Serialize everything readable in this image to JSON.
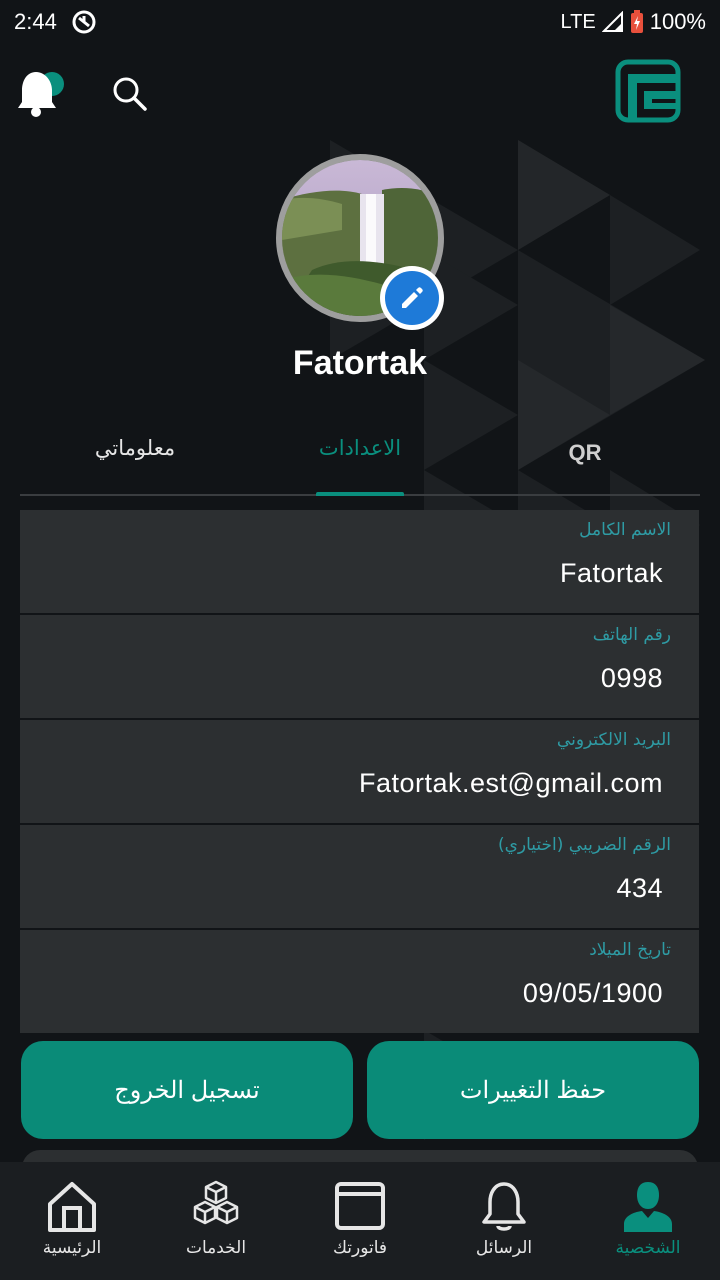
{
  "status_bar": {
    "time": "2:44",
    "network": "LTE",
    "battery": "100%"
  },
  "profile": {
    "name": "Fatortak"
  },
  "tabs": [
    {
      "label": "معلوماتي"
    },
    {
      "label": "الاعدادات"
    },
    {
      "label": "QR"
    }
  ],
  "form": {
    "fields": [
      {
        "label": "الاسم الكامل",
        "value": "Fatortak"
      },
      {
        "label": "رقم الهاتف",
        "value": "0998"
      },
      {
        "label": "البريد الالكتروني",
        "value": "Fatortak.est@gmail.com"
      },
      {
        "label": "الرقم الضريبي (اختياري)",
        "value": "434"
      },
      {
        "label": "تاريخ الميلاد",
        "value": "09/05/1900"
      }
    ]
  },
  "buttons": {
    "logout": "تسجيل الخروج",
    "save": "حفظ التغييرات"
  },
  "bottom_nav": [
    {
      "label": "الرئيسية",
      "icon": "home-icon"
    },
    {
      "label": "الخدمات",
      "icon": "cubes-icon"
    },
    {
      "label": "فاتورتك",
      "icon": "window-icon"
    },
    {
      "label": "الرسائل",
      "icon": "bell-icon"
    },
    {
      "label": "الشخصية",
      "icon": "person-icon",
      "active": true
    }
  ],
  "colors": {
    "accent": "#0a8b78",
    "background": "#111417",
    "field_bg": "#2c2f31",
    "label": "#2e9ba4"
  }
}
